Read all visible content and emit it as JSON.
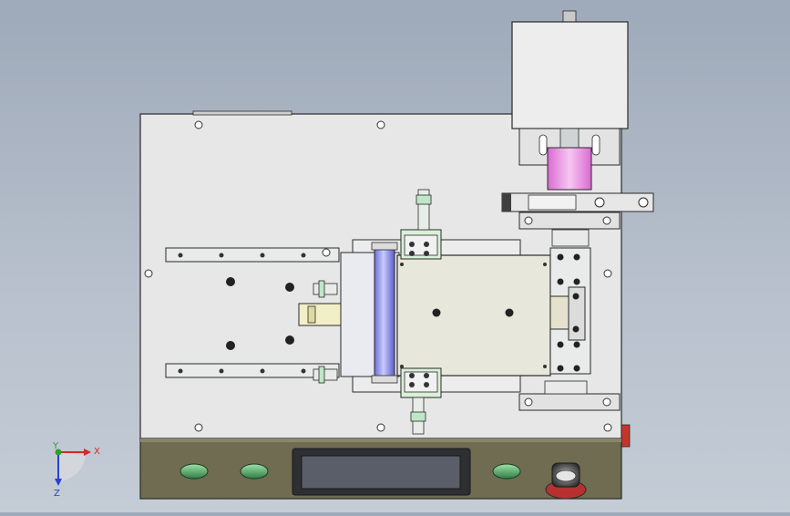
{
  "triad": {
    "x_label": "X",
    "y_label": "Y",
    "z_label": "Z"
  },
  "colors": {
    "background_top": "#9ea9b9",
    "background_bottom": "#c4ccd6",
    "plate": "#e6e7e6",
    "control_panel": "#6f6c52",
    "display": "#5a5e68",
    "green_button": "#4f9a63",
    "roller_blue": "#8f93e6",
    "pink_sleeve": "#ea8fe0",
    "emergency_red": "#b83030",
    "x_axis": "#d02a2a",
    "y_axis": "#2ba02b",
    "z_axis": "#2a3fd0"
  },
  "parts": {
    "motor": "motor-box",
    "sleeve": "pink-coupling",
    "roller": "blue-roller",
    "carriage": "slide-carriage",
    "panel": "control-panel",
    "display": "lcd-display",
    "estop": "emergency-stop"
  }
}
